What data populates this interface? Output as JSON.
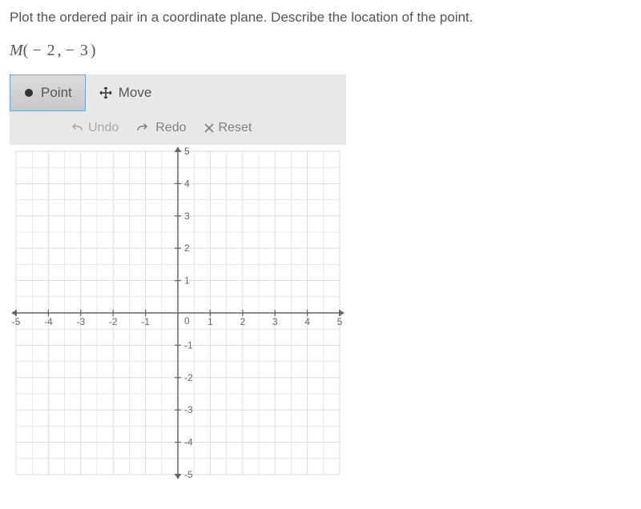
{
  "question": "Plot the ordered pair in a coordinate plane. Describe the location of the point.",
  "point": {
    "letter": "M",
    "open": "(",
    "x": "− 2",
    "comma": ",",
    "y": "− 3",
    "close": ")"
  },
  "tabs": {
    "point": "Point",
    "move": "Move"
  },
  "actions": {
    "undo": "Undo",
    "redo": "Redo",
    "reset": "Reset"
  },
  "chart_data": {
    "type": "scatter",
    "title": "",
    "xlabel": "",
    "ylabel": "",
    "xlim": [
      -5,
      5
    ],
    "ylim": [
      -5,
      5
    ],
    "x_ticks": [
      -5,
      -4,
      -3,
      -2,
      -1,
      0,
      1,
      2,
      3,
      4,
      5
    ],
    "y_ticks": [
      -5,
      -4,
      -3,
      -2,
      -1,
      1,
      2,
      3,
      4,
      5
    ],
    "grid": true,
    "grid_step": 0.5,
    "series": [
      {
        "name": "M",
        "values": []
      }
    ],
    "target_point": {
      "name": "M",
      "x": -2,
      "y": -3
    }
  }
}
